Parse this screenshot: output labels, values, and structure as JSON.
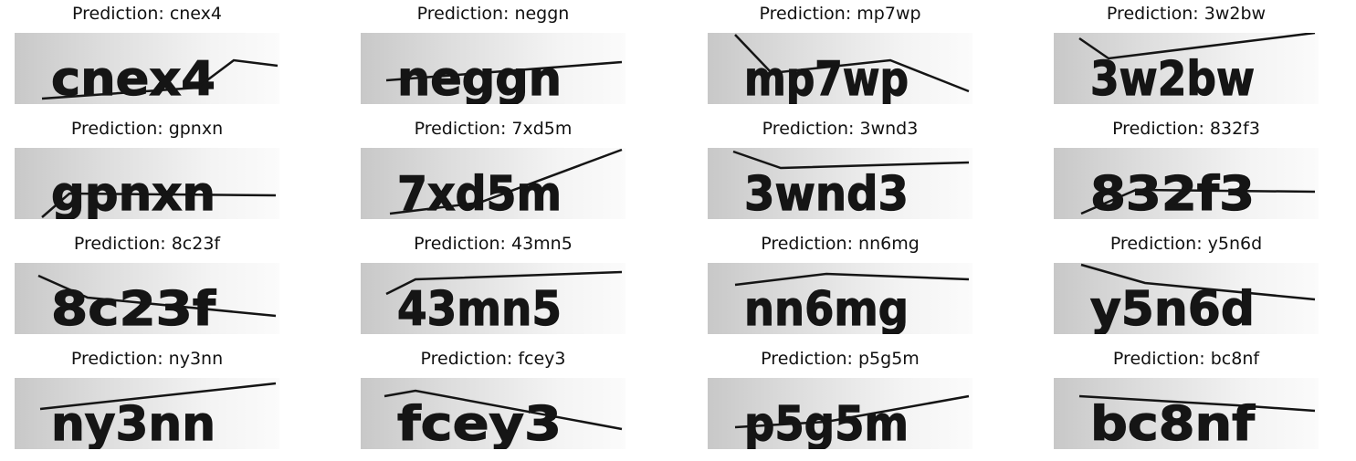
{
  "title_prefix": "Prediction: ",
  "samples": [
    {
      "prediction": "cnex4",
      "text": "cnex4"
    },
    {
      "prediction": "neggn",
      "text": "neggn"
    },
    {
      "prediction": "mp7wp",
      "text": "mp7wp"
    },
    {
      "prediction": "3w2bw",
      "text": "3w2bw"
    },
    {
      "prediction": "gpnxn",
      "text": "gpnxn"
    },
    {
      "prediction": "7xd5m",
      "text": "7xd5m"
    },
    {
      "prediction": "3wnd3",
      "text": "3wnd3"
    },
    {
      "prediction": "832f3",
      "text": "832f3"
    },
    {
      "prediction": "8c23f",
      "text": "8c23f"
    },
    {
      "prediction": "43mn5",
      "text": "43mn5"
    },
    {
      "prediction": "nn6mg",
      "text": "nn6mg"
    },
    {
      "prediction": "y5n6d",
      "text": "y5n6d"
    },
    {
      "prediction": "ny3nn",
      "text": "ny3nn"
    },
    {
      "prediction": "fcey3",
      "text": "fcey3"
    },
    {
      "prediction": "p5g5m",
      "text": "p5g5m"
    },
    {
      "prediction": "bc8nf",
      "text": "bc8nf"
    }
  ],
  "colors": {
    "ink": "#151515",
    "background_left": "#c8c8c8",
    "background_right": "#fbfbfb"
  }
}
